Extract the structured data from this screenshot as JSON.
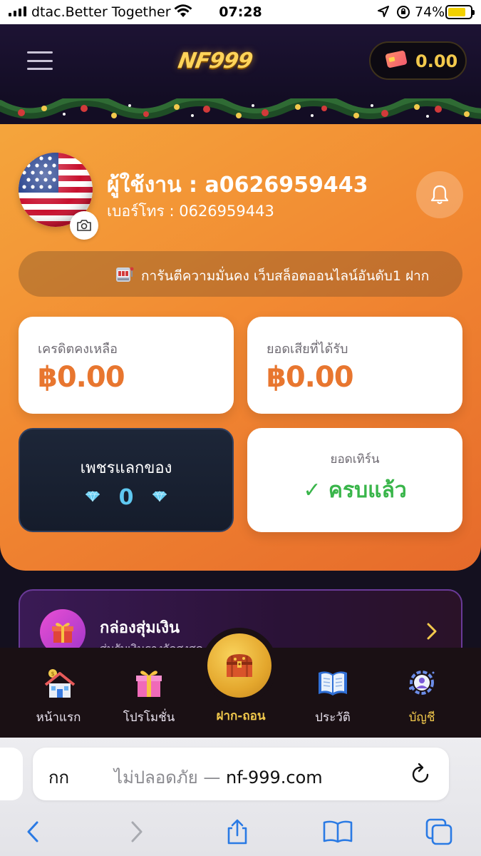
{
  "status_bar": {
    "carrier": "dtac.Better Together",
    "time": "07:28",
    "battery": "74%",
    "icons": [
      "signal-icon",
      "wifi-icon",
      "location-icon",
      "rotation-lock-icon",
      "battery-charging-icon"
    ]
  },
  "header": {
    "logo_text": "NF999",
    "wallet_amount": "0.00",
    "menu_icon": "hamburger-icon",
    "wallet_icon": "credit-card-icon"
  },
  "profile": {
    "username": "ผู้ใช้งาน : a0626959443",
    "phone": "เบอร์โทร : 0626959443",
    "avatar": "us-flag-avatar",
    "camera_icon": "camera-icon",
    "bell_icon": "bell-icon"
  },
  "announcement": {
    "icon": "slot-machine-icon",
    "text": "การันตีความมั่นคง เว็บสล็อตออนไลน์อันดับ1 ฝาก"
  },
  "stats": {
    "credit_label": "เครดิตคงเหลือ",
    "credit_value": "฿0.00",
    "loss_label": "ยอดเสียที่ได้รับ",
    "loss_value": "฿0.00",
    "diamond_label": "เพชรแลกของ",
    "diamond_count": "0",
    "turnover_label": "ยอดเทิร์น",
    "turnover_status": "✓ ครบแล้ว"
  },
  "promo_banner": {
    "title": "กล่องสุ่มเงิน",
    "subtitle": "สุ่มรับเงินรางวัลสูงสุด ... บาท!",
    "icon": "gift-box-icon"
  },
  "bottom_nav": {
    "items": [
      {
        "label": "หน้าแรก",
        "icon": "home-icon"
      },
      {
        "label": "โปรโมชั่น",
        "icon": "gift-icon"
      },
      {
        "label": "ฝาก-ถอน",
        "icon": "treasure-chest-icon"
      },
      {
        "label": "ประวัติ",
        "icon": "book-icon"
      },
      {
        "label": "บัญชี",
        "icon": "user-gear-icon"
      }
    ],
    "active_color": "#f2c94c"
  },
  "browser": {
    "aa_label": "กก",
    "insecure_label": "ไม่ปลอดภัย —",
    "domain": "nf-999.com"
  },
  "colors": {
    "orange_start": "#f4a53c",
    "orange_end": "#e66a2b",
    "accent_gold": "#f2c94c",
    "success_green": "#39b54a",
    "value_orange": "#e8762f"
  }
}
